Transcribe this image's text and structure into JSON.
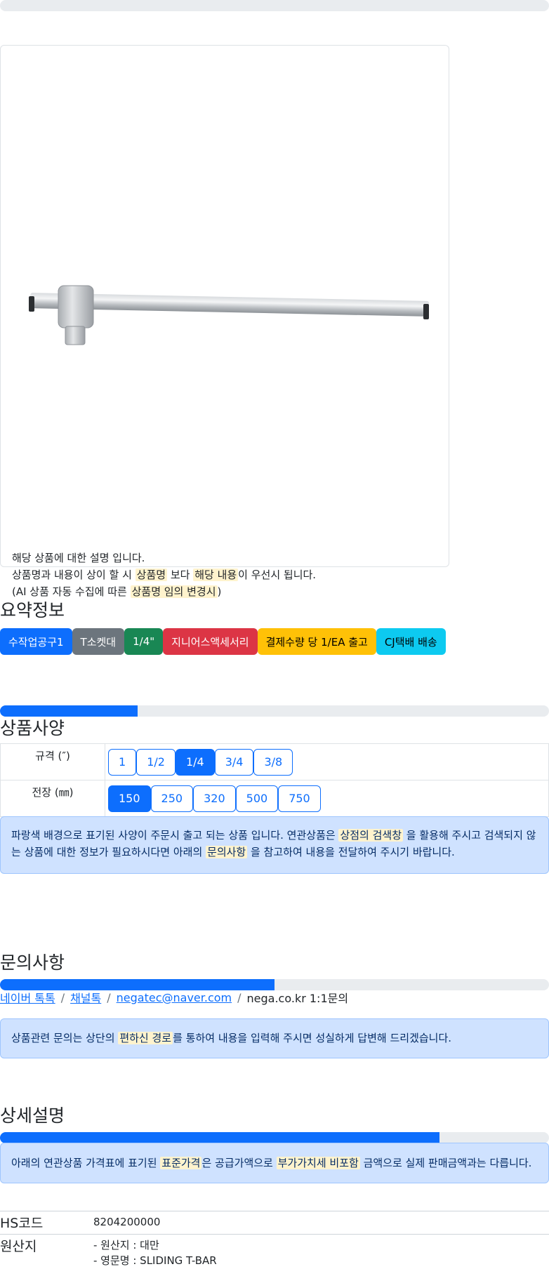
{
  "product_card": {
    "desc_line1": "해당 상품에 대한 설명 입니다.",
    "desc_line2_a": "상품명과 내용이 상이 할 시 ",
    "desc_line2_hl1": "상품명",
    "desc_line2_b": " 보다 ",
    "desc_line2_hl2": "해당 내용",
    "desc_line2_c": "이 우선시 됩니다.",
    "desc_line3_a": "(AI 상품 자동 수집에 따른 ",
    "desc_line3_hl": "상품명 임의 변경시",
    "desc_line3_b": ")"
  },
  "summary": {
    "title": "요약정보",
    "badges": [
      {
        "label": "수작업공구1",
        "color": "#0d6efd",
        "text_color": "#ffffff"
      },
      {
        "label": "T소켓대",
        "color": "#6c757d",
        "text_color": "#ffffff"
      },
      {
        "label": "1/4\"",
        "color": "#198754",
        "text_color": "#ffffff"
      },
      {
        "label": "지니어스액세서리",
        "color": "#dc3545",
        "text_color": "#ffffff"
      },
      {
        "label": "결제수량 당 1/EA 출고",
        "color": "#ffc107",
        "text_color": "#000000"
      },
      {
        "label": "CJ택배 배송",
        "color": "#0dcaf0",
        "text_color": "#000000"
      }
    ]
  },
  "spec": {
    "progress": 0.25,
    "title": "상품사양",
    "rows": [
      {
        "label": "규격 (″)",
        "options": [
          "1",
          "1/2",
          "1/4",
          "3/4",
          "3/8"
        ],
        "selected": 2
      },
      {
        "label": "전장 (㎜)",
        "options": [
          "150",
          "250",
          "320",
          "500",
          "750"
        ],
        "selected": 0
      }
    ],
    "notice_a": "파랑색 배경으로 표기된 사양이 주문시 출고 되는 상품 입니다. 연관상품은 ",
    "notice_hl1": "상점의 검색창",
    "notice_b": " 을 활용해 주시고 검색되지 않는 상품에 대한 정보가 필요하시다면 아래의 ",
    "notice_hl2": "문의사항",
    "notice_c": " 을 참고하여 내용을 전달하여 주시기 바랍니다."
  },
  "inquiry": {
    "title": "문의사항",
    "progress": 0.5,
    "links": [
      "네이버 톡톡",
      "채널톡",
      "negatec@naver.com"
    ],
    "plain": "nega.co.kr 1:1문의",
    "separator": "/",
    "notice_a": "상품관련 문의는 상단의 ",
    "notice_hl": "편하신 경로",
    "notice_b": "를 통하여 내용을 입력해 주시면 성실하게 답변해 드리겠습니다."
  },
  "detail": {
    "title": "상세설명",
    "progress": 0.8,
    "notice_a": "아래의 연관상품 가격표에 표기된 ",
    "notice_hl1": "표준가격",
    "notice_b": "은 공급가액으로 ",
    "notice_hl2": "부가가치세 비포함",
    "notice_c": " 금액으로 실제 판매금액과는 다릅니다.",
    "info": [
      {
        "key": "HS코드",
        "values": [
          "8204200000"
        ]
      },
      {
        "key": "원산지",
        "values": [
          "- 원산지 : 대만",
          "- 영문명 : SLIDING T-BAR"
        ]
      }
    ]
  }
}
